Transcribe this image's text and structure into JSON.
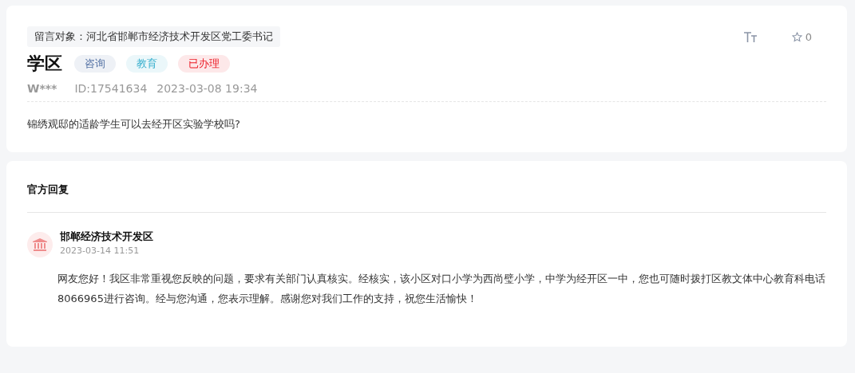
{
  "message": {
    "target": "留言对象：河北省邯郸市经济技术开发区党工委书记",
    "title": "学区",
    "tags": [
      {
        "label": "咨询",
        "color": "#eef1f6"
      },
      {
        "label": "教育",
        "color": "#ebf7fa"
      },
      {
        "label": "已办理",
        "color": "#fde8e9"
      }
    ],
    "author": "W***",
    "id": "ID:17541634",
    "time": "2023-03-08 19:34",
    "likes": "0",
    "body": "锦绣观邸的适龄学生可以去经开区实验学校吗?"
  },
  "reply": {
    "heading": "官方回复",
    "org": "邯郸经济技术开发区",
    "time": "2023-03-14 11:51",
    "body": "网友您好！我区非常重视您反映的问题，要求有关部门认真核实。经核实，该小区对口小学为西尚璧小学，中学为经开区一中，您也可随时拨打区教文体中心教育科电话8066965进行咨询。经与您沟通，您表示理解。感谢您对我们工作的支持，祝您生活愉快！"
  }
}
